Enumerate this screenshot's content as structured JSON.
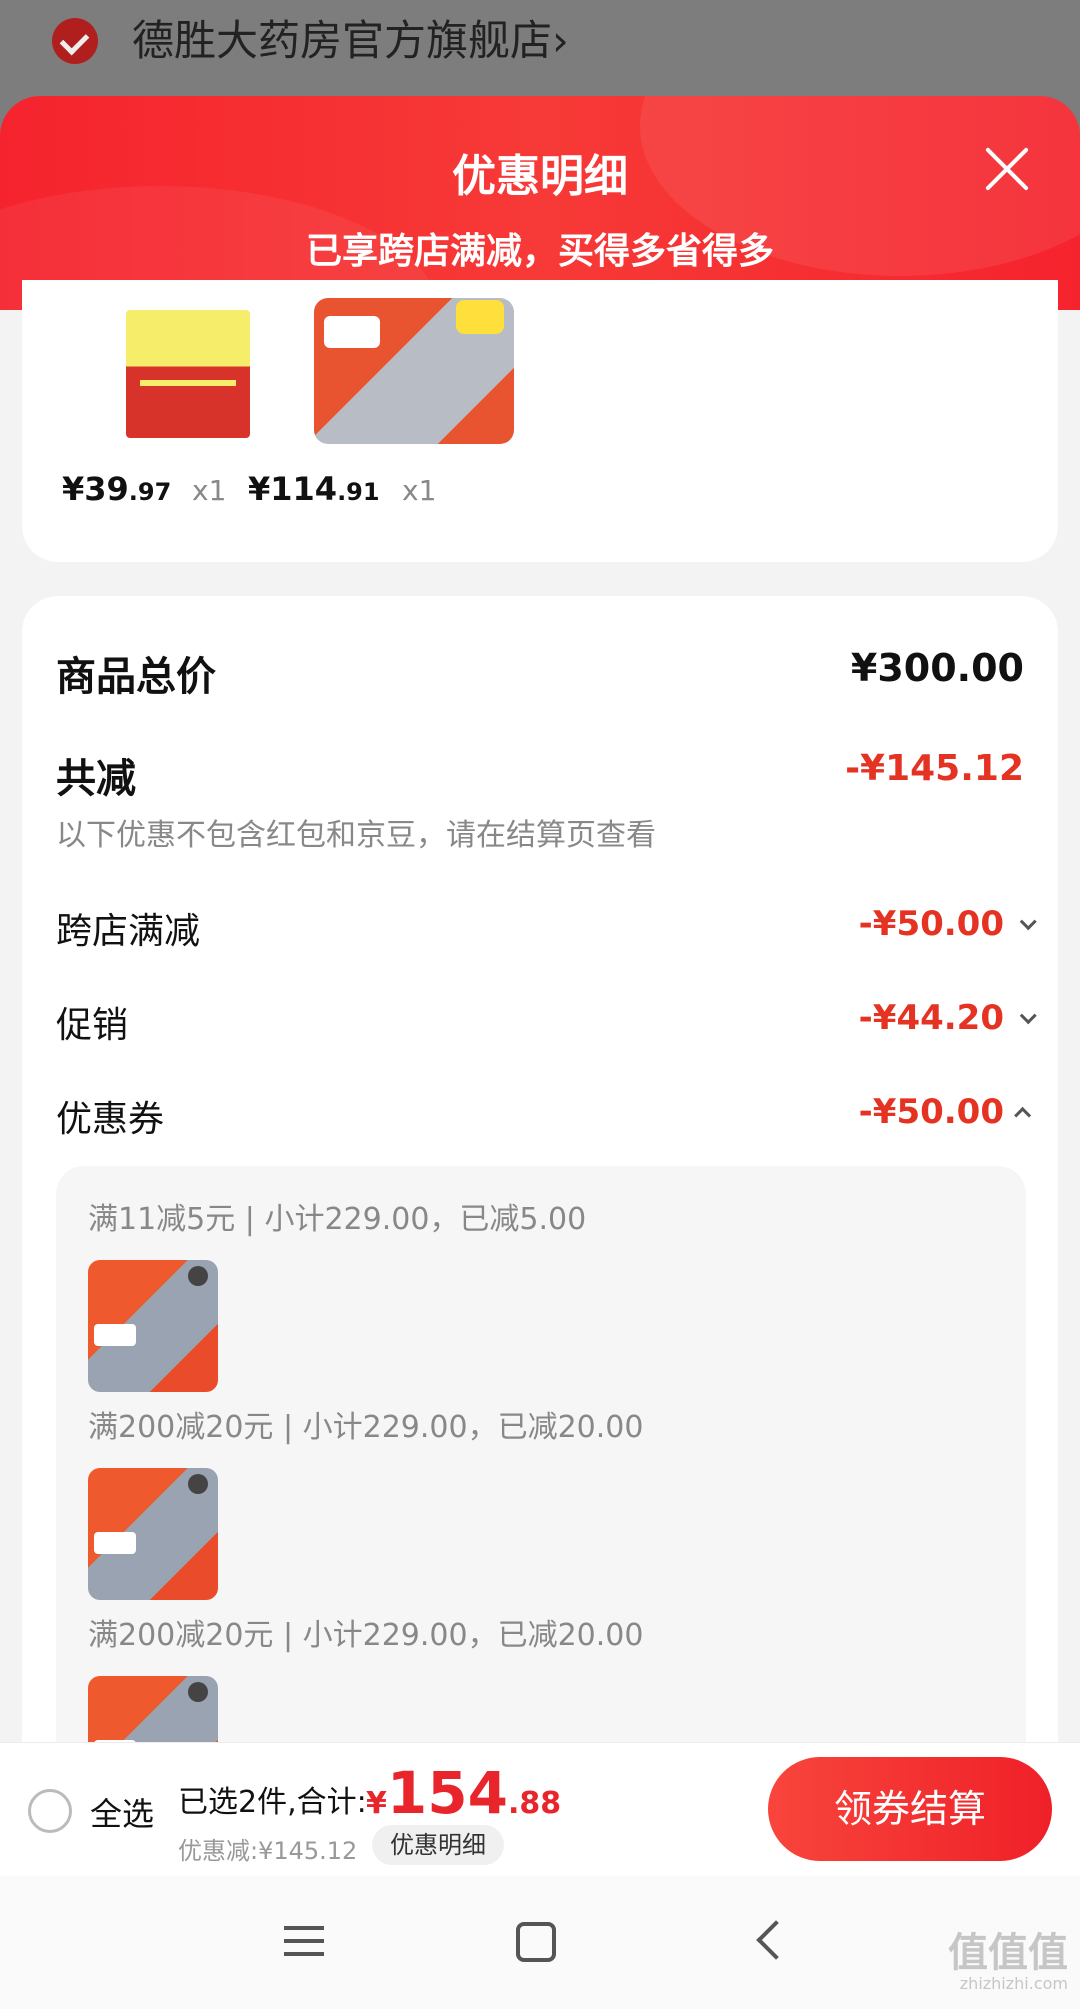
{
  "store": {
    "name": "德胜大药房官方旗舰店",
    "chevron": "›"
  },
  "sheet": {
    "title": "优惠明细",
    "subtitle": "已享跨店满减，买得多省得多",
    "close_icon": "close-icon"
  },
  "products": [
    {
      "price_int": "¥39",
      "price_dec": ".97",
      "qty": "x1",
      "thumb": "medicine-box-image"
    },
    {
      "price_int": "¥114",
      "price_dec": ".91",
      "qty": "x1",
      "thumb": "rice-cooker-image"
    }
  ],
  "summary": {
    "total_label": "商品总价",
    "total_value": "¥300.00",
    "reduce_label": "共减",
    "reduce_value": "-¥145.12",
    "note": "以下优惠不包含红包和京豆，请在结算页查看",
    "rows": [
      {
        "label": "跨店满减",
        "value": "-¥50.00",
        "chevron": "down"
      },
      {
        "label": "促销",
        "value": "-¥44.20",
        "chevron": "down"
      },
      {
        "label": "优惠券",
        "value": "-¥50.00",
        "chevron": "up"
      }
    ]
  },
  "coupons": [
    {
      "text": "满11减5元 | 小计229.00，已减5.00"
    },
    {
      "text": "满200减20元 | 小计229.00，已减20.00"
    },
    {
      "text": "满200减20元 | 小计229.00，已减20.00"
    }
  ],
  "action_bar": {
    "select_all": "全选",
    "selected_text": "已选2件,合计:",
    "total_yen": "¥",
    "total_int": "154",
    "total_dec": ".88",
    "discount_text": "优惠减:¥145.12",
    "detail_pill": "优惠明细",
    "checkout": "领券结算"
  },
  "watermark": {
    "logo": "值值值",
    "url": "zhizhizhi.com"
  },
  "colors": {
    "accent": "#e8252b",
    "header": "#f5232d"
  }
}
